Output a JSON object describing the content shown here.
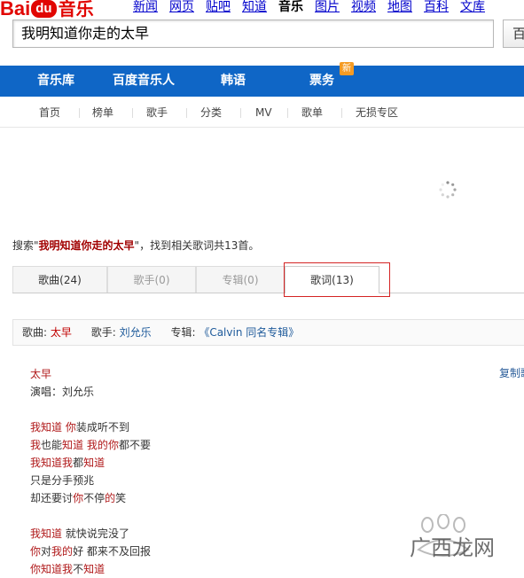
{
  "logo": {
    "bai": "Bai",
    "du": "du",
    "music": "音乐"
  },
  "topnav": {
    "items": [
      "新闻",
      "网页",
      "贴吧",
      "知道",
      "音乐",
      "图片",
      "视频",
      "地图",
      "百科",
      "文库"
    ],
    "current_index": 4
  },
  "search": {
    "query": "我明知道你走的太早",
    "button_label": "百"
  },
  "main_nav": {
    "items": [
      "音乐库",
      "百度音乐人",
      "韩语",
      "票务"
    ],
    "badge": "新",
    "color": "#0f66c6"
  },
  "sub_nav": {
    "items": [
      "首页",
      "榜单",
      "歌手",
      "分类",
      "MV",
      "歌单",
      "无损专区"
    ]
  },
  "summary": {
    "prefix": "搜索\"",
    "query": "我明知道你走的太早",
    "suffix": "\"，找到相关歌词共13首。"
  },
  "tabs": [
    {
      "label": "歌曲(24)"
    },
    {
      "label": "歌手(0)"
    },
    {
      "label": "专辑(0)"
    },
    {
      "label": "歌词(13)",
      "active": true
    }
  ],
  "info_bar": {
    "song_label": "歌曲:",
    "song": "太早",
    "artist_label": "歌手:",
    "artist": "刘允乐",
    "album_label": "专辑:",
    "album": "《Calvin 同名专辑》"
  },
  "lyrics": {
    "title": "太早",
    "singer_line": "演唱：刘允乐",
    "copy_label": "复制歌",
    "block1": [
      "我知道 你装成听不到",
      "我也能知道 我的你都不要",
      "我知道我都知道",
      "只是分手预兆",
      "却还要讨你不停的笑"
    ],
    "block2": [
      "我知道 就快说完没了",
      "你对我的好 都来不及回报",
      "你知道我不知道"
    ]
  },
  "watermark": {
    "text": "广西龙网"
  }
}
